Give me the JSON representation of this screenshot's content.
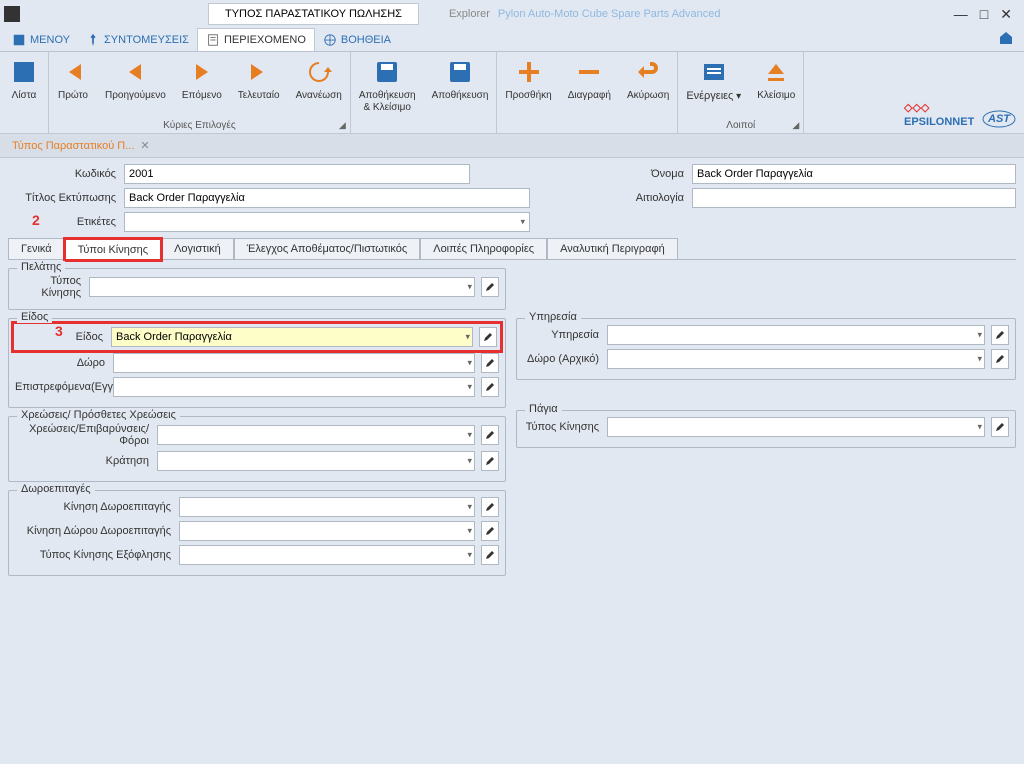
{
  "titlebar": {
    "title_tab": "ΤΥΠΟΣ ΠΑΡΑΣΤΑΤΙΚΟΥ ΠΩΛΗΣΗΣ",
    "explorer": "Explorer",
    "breadcrumb": "Pylon Auto-Moto Cube Spare Parts Advanced"
  },
  "menubar": {
    "menu": "ΜΕΝΟΥ",
    "shortcuts": "ΣΥΝΤΟΜΕΥΣΕΙΣ",
    "content": "ΠΕΡΙΕΧΟΜΕΝΟ",
    "help": "ΒΟΗΘΕΙΑ"
  },
  "toolbar": {
    "list": "Λίστα",
    "first": "Πρώτο",
    "previous": "Προηγούμενο",
    "next": "Επόμενο",
    "last": "Τελευταίο",
    "refresh": "Ανανέωση",
    "save_close": "Αποθήκευση\n& Κλείσιμο",
    "save": "Αποθήκευση",
    "add": "Προσθήκη",
    "delete": "Διαγραφή",
    "cancel": "Ακύρωση",
    "actions": "Ενέργειες",
    "close": "Κλείσιμο",
    "group_main": "Κύριες Επιλογές",
    "group_other": "Λοιποί"
  },
  "doc_tab": "Τύπος Παραστατικού Π...",
  "form": {
    "code_label": "Κωδικός",
    "code_value": "2001",
    "name_label": "Όνομα",
    "name_value": "Back Order Παραγγελία",
    "print_title_label": "Τίτλος Εκτύπωσης",
    "print_title_value": "Back Order Παραγγελία",
    "reason_label": "Αιτιολογία",
    "reason_value": "",
    "tags_label": "Ετικέτες",
    "tags_value": ""
  },
  "annotations": {
    "two": "2",
    "three": "3"
  },
  "subtabs": {
    "general": "Γενικά",
    "movement_types": "Τύποι Κίνησης",
    "accounting": "Λογιστική",
    "stock_credit": "Έλεγχος Αποθέματος/Πιστωτικός",
    "other_info": "Λοιπές Πληροφορίες",
    "analytical": "Αναλυτική Περιγραφή"
  },
  "groups": {
    "customer": "Πελάτης",
    "movement_type_label": "Τύπος Κίνησης",
    "item": "Είδος",
    "item_label": "Είδος",
    "item_value": "Back Order Παραγγελία",
    "gift_label": "Δώρο",
    "returned_label": "Επιστρεφόμενα(Εγγ.)",
    "service": "Υπηρεσία",
    "service_label": "Υπηρεσία",
    "gift_original_label": "Δώρο (Αρχικό)",
    "charges": "Χρεώσεις/ Πρόσθετες Χρεώσεις",
    "charges_label": "Χρεώσεις/Επιβαρύνσεις/Φόροι",
    "withholding_label": "Κράτηση",
    "fixed_assets": "Πάγια",
    "fixed_movement_label": "Τύπος Κίνησης",
    "gift_vouchers": "Δωροεπιταγές",
    "voucher_movement_label": "Κίνηση Δωροεπιταγής",
    "voucher_gift_movement_label": "Κίνηση Δώρου Δωροεπιταγής",
    "redemption_type_label": "Τύπος Κίνησης Εξόφλησης"
  }
}
